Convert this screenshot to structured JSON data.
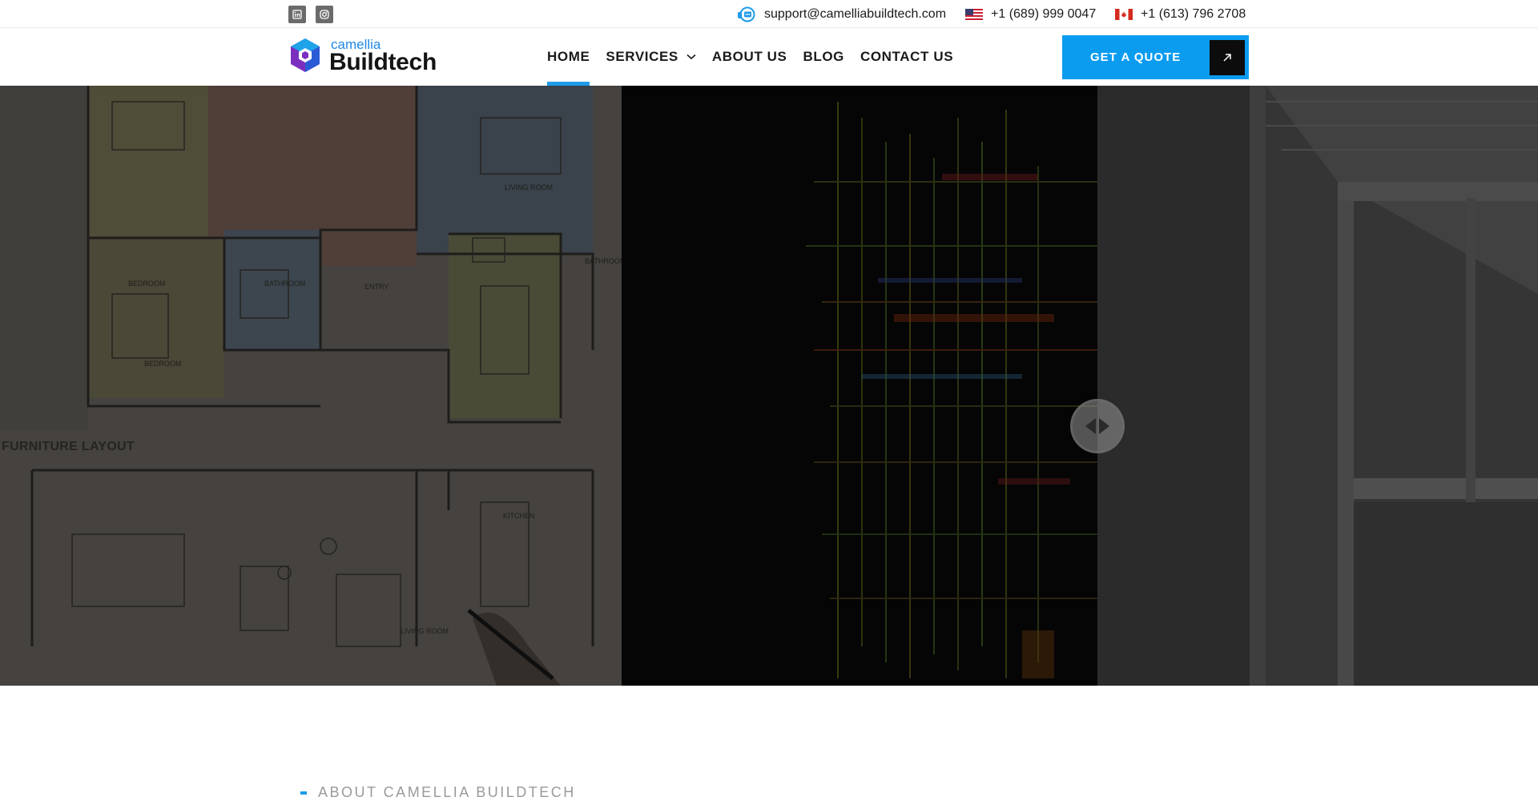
{
  "topbar": {
    "social": [
      {
        "name": "linkedin-icon"
      },
      {
        "name": "instagram-icon"
      }
    ],
    "email": "support@camelliabuildtech.com",
    "phone_us": "+1 (689) 999 0047",
    "phone_ca": "+1 (613) 796 2708"
  },
  "header": {
    "logo_small": "camellia",
    "logo_big": "Buildtech",
    "nav": [
      {
        "label": "HOME",
        "active": true
      },
      {
        "label": "SERVICES",
        "dropdown": true
      },
      {
        "label": "ABOUT US"
      },
      {
        "label": "BLOG"
      },
      {
        "label": "CONTACT US"
      }
    ],
    "cta_label": "GET A QUOTE"
  },
  "hero": {
    "plan_label": "FURNITURE LAYOUT",
    "plan_room_labels": [
      "LIVING ROOM",
      "BATHROOM",
      "ENTRY",
      "BATHROOM",
      "BEDROOM",
      "KITCHEN",
      "LIVING ROOM"
    ]
  },
  "about": {
    "kicker": "ABOUT CAMELLIA BUILDTECH"
  },
  "colors": {
    "accent": "#0b9cf0",
    "underline": "#1e9be9",
    "dark": "#0c0c0c"
  }
}
